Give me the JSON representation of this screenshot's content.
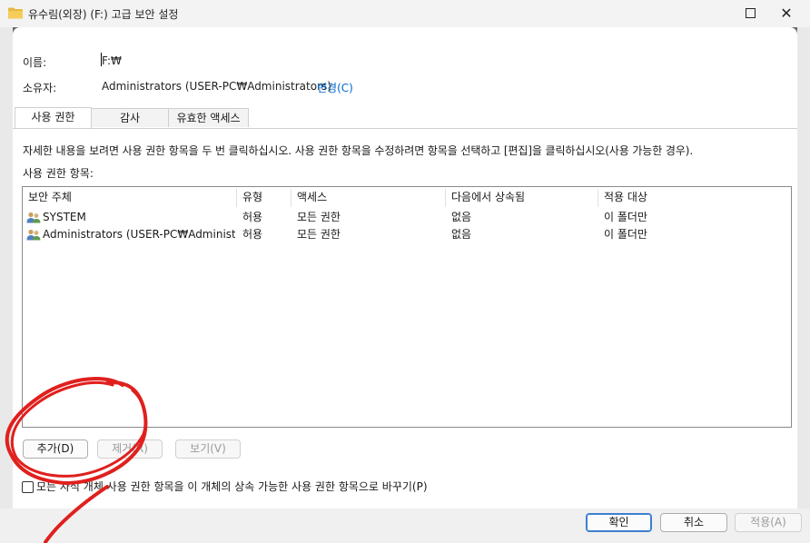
{
  "window": {
    "title": "유수림(외장) (F:) 고급 보안 설정",
    "close_glyph": "✕"
  },
  "fields": {
    "name_label": "이름:",
    "name_value": "F:₩",
    "owner_label": "소유자:",
    "owner_value": "Administrators (USER-PC₩Administrators)",
    "change_link": "변경(C)"
  },
  "tabs": [
    {
      "label": "사용 권한",
      "active": true
    },
    {
      "label": "감사",
      "active": false
    },
    {
      "label": "유효한 액세스",
      "active": false
    }
  ],
  "description": "자세한 내용을 보려면 사용 권한 항목을 두 번 클릭하십시오. 사용 권한 항목을 수정하려면 항목을 선택하고 [편집]을 클릭하십시오(사용 가능한 경우).",
  "list_title": "사용 권한 항목:",
  "table": {
    "columns": [
      "보안 주체",
      "유형",
      "액세스",
      "다음에서 상속됨",
      "적용 대상"
    ],
    "rows": [
      {
        "principal": "SYSTEM",
        "type": "허용",
        "access": "모든 권한",
        "inherited": "없음",
        "applies": "이 폴더만",
        "icon": "users-icon"
      },
      {
        "principal": "Administrators (USER-PC₩Administra...",
        "type": "허용",
        "access": "모든 권한",
        "inherited": "없음",
        "applies": "이 폴더만",
        "icon": "users-icon"
      }
    ]
  },
  "buttons": {
    "add": "추가(D)",
    "remove": "제거(R)",
    "view": "보기(V)"
  },
  "checkbox": {
    "label": "모든 자식 개체 사용 권한 항목을 이 개체의 상속 가능한 사용 권한 항목으로 바꾸기(P)",
    "checked": false
  },
  "footer": {
    "ok": "확인",
    "cancel": "취소",
    "apply": "적용(A)"
  },
  "colors": {
    "link": "#0066cc",
    "annotation": "#e0201e",
    "folder_icon": "#e8b93d"
  }
}
